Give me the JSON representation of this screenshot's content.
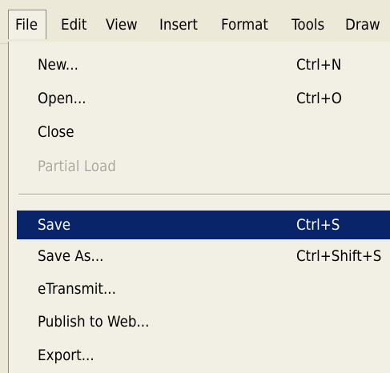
{
  "menubar": {
    "items": [
      {
        "label": "File"
      },
      {
        "label": "Edit"
      },
      {
        "label": "View"
      },
      {
        "label": "Insert"
      },
      {
        "label": "Format"
      },
      {
        "label": "Tools"
      },
      {
        "label": "Draw"
      }
    ],
    "active": "File"
  },
  "file_menu": {
    "items": [
      {
        "label": "New...",
        "shortcut": "Ctrl+N",
        "enabled": true
      },
      {
        "label": "Open...",
        "shortcut": "Ctrl+O",
        "enabled": true
      },
      {
        "label": "Close",
        "shortcut": "",
        "enabled": true
      },
      {
        "label": "Partial Load",
        "shortcut": "",
        "enabled": false
      },
      {
        "label": "Save",
        "shortcut": "Ctrl+S",
        "enabled": true,
        "highlighted": true
      },
      {
        "label": "Save As...",
        "shortcut": "Ctrl+Shift+S",
        "enabled": true
      },
      {
        "label": "eTransmit...",
        "shortcut": "",
        "enabled": true
      },
      {
        "label": "Publish to Web...",
        "shortcut": "",
        "enabled": true
      },
      {
        "label": "Export...",
        "shortcut": "",
        "enabled": true
      }
    ]
  },
  "colors": {
    "menu_background": "#ece9d8",
    "highlight": "#0a246a",
    "highlight_text": "#ffffff",
    "disabled_text": "#a8a69a"
  }
}
